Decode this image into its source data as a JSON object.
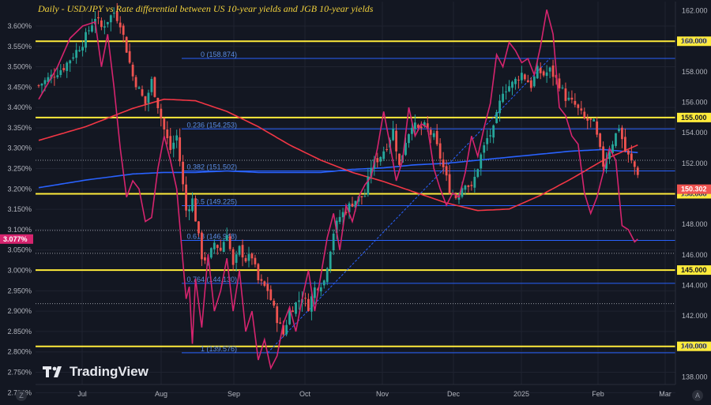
{
  "title": "Daily - USD/JPY vs Rate differential between US 10-year yields and JGB 10-year yields",
  "brand": "TradingView",
  "axis_buttons": {
    "left": "Z",
    "right": "A"
  },
  "colors": {
    "background": "#131722",
    "grid": "#1f2330",
    "candle_up": "#26a69a",
    "candle_down": "#ef5350",
    "spread_line": "#d6246e",
    "ma_red": "#f23645",
    "ma_blue": "#2962ff",
    "levels": "#ffeb3b",
    "fib": "#2962ff"
  },
  "chart_data": {
    "type": "candlestick",
    "left_axis": {
      "unit": "%",
      "range": [
        2.72,
        3.66
      ],
      "ticks": [
        "3.600%",
        "3.550%",
        "3.500%",
        "3.450%",
        "3.400%",
        "3.350%",
        "3.300%",
        "3.250%",
        "3.200%",
        "3.150%",
        "3.100%",
        "3.050%",
        "3.000%",
        "2.950%",
        "2.900%",
        "2.850%",
        "2.800%",
        "2.750%",
        "2.700%"
      ]
    },
    "right_axis": {
      "range": [
        137.5,
        162.6
      ],
      "ticks": [
        "162.000",
        "160.000",
        "158.000",
        "156.000",
        "154.000",
        "152.000",
        "150.000",
        "148.000",
        "146.000",
        "144.000",
        "142.000",
        "140.000",
        "138.000"
      ]
    },
    "x_ticks": [
      "Jul",
      "Aug",
      "Sep",
      "Oct",
      "Nov",
      "Dec",
      "2025",
      "Feb",
      "Mar"
    ],
    "last_price": "150.302",
    "last_spread": "3.077%",
    "horizontal_levels": [
      "160.000",
      "155.000",
      "150.000",
      "145.000",
      "140.000"
    ],
    "fib_levels": [
      {
        "label": "0 (158.874)",
        "price": 158.874
      },
      {
        "label": "0.236 (154.253)",
        "price": 154.253
      },
      {
        "label": "0.382 (151.502)",
        "price": 151.502
      },
      {
        "label": "0.5 (149.225)",
        "price": 149.225
      },
      {
        "label": "0.618 (146.948)",
        "price": 146.948
      },
      {
        "label": "0.764 (144.130)",
        "price": 144.13
      },
      {
        "label": "1 (139.576)",
        "price": 139.576
      }
    ],
    "dotted_levels": [
      152.2,
      147.6,
      146.1,
      142.8
    ],
    "usdjpy_key_points": [
      [
        0,
        157.1
      ],
      [
        8,
        158.3
      ],
      [
        14,
        159.9
      ],
      [
        18,
        161.6
      ],
      [
        20,
        160.9
      ],
      [
        24,
        161.9
      ],
      [
        26,
        161.2
      ],
      [
        30,
        157.7
      ],
      [
        34,
        155.9
      ],
      [
        36,
        157.4
      ],
      [
        40,
        154.2
      ],
      [
        42,
        152.9
      ],
      [
        44,
        153.8
      ],
      [
        47,
        148.9
      ],
      [
        49,
        149.6
      ],
      [
        52,
        145.9
      ],
      [
        54,
        145.6
      ],
      [
        56,
        146.8
      ],
      [
        58,
        146.3
      ],
      [
        60,
        147.5
      ],
      [
        62,
        145.2
      ],
      [
        64,
        146.4
      ],
      [
        66,
        145.7
      ],
      [
        68,
        145.9
      ],
      [
        70,
        144.3
      ],
      [
        73,
        143.7
      ],
      [
        76,
        141.8
      ],
      [
        78,
        140.8
      ],
      [
        80,
        142.3
      ],
      [
        84,
        143.3
      ],
      [
        86,
        142.6
      ],
      [
        88,
        143.8
      ],
      [
        91,
        144.3
      ],
      [
        94,
        147.5
      ],
      [
        96,
        148.5
      ],
      [
        99,
        149.2
      ],
      [
        101,
        149.6
      ],
      [
        104,
        149.9
      ],
      [
        106,
        151.8
      ],
      [
        109,
        152.5
      ],
      [
        111,
        153.2
      ],
      [
        113,
        154.2
      ],
      [
        115,
        151.8
      ],
      [
        117,
        153.5
      ],
      [
        119,
        154.6
      ],
      [
        121,
        154.2
      ],
      [
        123,
        154.4
      ],
      [
        126,
        153.7
      ],
      [
        128,
        152.4
      ],
      [
        131,
        150.3
      ],
      [
        133,
        149.8
      ],
      [
        136,
        150.8
      ],
      [
        138,
        150.3
      ],
      [
        141,
        152.5
      ],
      [
        143,
        153.6
      ],
      [
        145,
        154.2
      ],
      [
        148,
        156.8
      ],
      [
        151,
        157.2
      ],
      [
        154,
        157.9
      ],
      [
        157,
        157.1
      ],
      [
        159,
        158.1
      ],
      [
        161,
        157.8
      ],
      [
        163,
        158.1
      ],
      [
        166,
        157.2
      ],
      [
        168,
        156.3
      ],
      [
        171,
        155.8
      ],
      [
        174,
        154.9
      ],
      [
        177,
        154.6
      ],
      [
        180,
        151.9
      ],
      [
        183,
        153.4
      ],
      [
        185,
        154.4
      ],
      [
        187,
        152.8
      ],
      [
        189,
        152.1
      ],
      [
        191,
        151.4
      ]
    ],
    "spread_key_points": [
      [
        0,
        3.42
      ],
      [
        6,
        3.5
      ],
      [
        10,
        3.57
      ],
      [
        14,
        3.6
      ],
      [
        18,
        3.61
      ],
      [
        20,
        3.5
      ],
      [
        22,
        3.58
      ],
      [
        24,
        3.45
      ],
      [
        26,
        3.3
      ],
      [
        28,
        3.18
      ],
      [
        30,
        3.22
      ],
      [
        32,
        3.2
      ],
      [
        34,
        3.12
      ],
      [
        36,
        3.13
      ],
      [
        38,
        3.25
      ],
      [
        40,
        3.33
      ],
      [
        42,
        3.27
      ],
      [
        44,
        3.2
      ],
      [
        46,
        3.02
      ],
      [
        47,
        2.93
      ],
      [
        48,
        2.96
      ],
      [
        49,
        2.82
      ],
      [
        50,
        2.98
      ],
      [
        52,
        2.86
      ],
      [
        54,
        3.04
      ],
      [
        56,
        2.9
      ],
      [
        58,
        2.95
      ],
      [
        60,
        3.03
      ],
      [
        62,
        2.9
      ],
      [
        64,
        3.0
      ],
      [
        66,
        2.85
      ],
      [
        68,
        2.9
      ],
      [
        70,
        2.78
      ],
      [
        72,
        2.83
      ],
      [
        74,
        2.76
      ],
      [
        76,
        2.79
      ],
      [
        78,
        2.87
      ],
      [
        80,
        2.91
      ],
      [
        82,
        2.85
      ],
      [
        84,
        2.93
      ],
      [
        86,
        3.0
      ],
      [
        88,
        2.9
      ],
      [
        90,
        2.99
      ],
      [
        92,
        3.08
      ],
      [
        94,
        3.14
      ],
      [
        96,
        3.05
      ],
      [
        98,
        3.16
      ],
      [
        100,
        3.12
      ],
      [
        102,
        3.18
      ],
      [
        104,
        3.21
      ],
      [
        106,
        3.23
      ],
      [
        108,
        3.3
      ],
      [
        110,
        3.39
      ],
      [
        112,
        3.31
      ],
      [
        114,
        3.22
      ],
      [
        116,
        3.27
      ],
      [
        118,
        3.4
      ],
      [
        120,
        3.33
      ],
      [
        122,
        3.36
      ],
      [
        124,
        3.35
      ],
      [
        126,
        3.25
      ],
      [
        128,
        3.2
      ],
      [
        130,
        3.16
      ],
      [
        132,
        3.19
      ],
      [
        134,
        3.18
      ],
      [
        136,
        3.24
      ],
      [
        138,
        3.33
      ],
      [
        140,
        3.28
      ],
      [
        142,
        3.35
      ],
      [
        144,
        3.41
      ],
      [
        146,
        3.53
      ],
      [
        148,
        3.5
      ],
      [
        150,
        3.56
      ],
      [
        152,
        3.54
      ],
      [
        154,
        3.51
      ],
      [
        156,
        3.52
      ],
      [
        158,
        3.48
      ],
      [
        160,
        3.55
      ],
      [
        162,
        3.64
      ],
      [
        164,
        3.58
      ],
      [
        166,
        3.4
      ],
      [
        168,
        3.38
      ],
      [
        170,
        3.33
      ],
      [
        172,
        3.31
      ],
      [
        174,
        3.19
      ],
      [
        176,
        3.14
      ],
      [
        178,
        3.18
      ],
      [
        180,
        3.24
      ],
      [
        182,
        3.3
      ],
      [
        184,
        3.27
      ],
      [
        186,
        3.11
      ],
      [
        188,
        3.1
      ],
      [
        190,
        3.07
      ],
      [
        191,
        3.077
      ]
    ],
    "red_ma_key_points": [
      [
        0,
        153.5
      ],
      [
        15,
        154.4
      ],
      [
        30,
        155.6
      ],
      [
        40,
        156.2
      ],
      [
        50,
        156.1
      ],
      [
        60,
        155.4
      ],
      [
        70,
        154.4
      ],
      [
        80,
        153.2
      ],
      [
        90,
        152.2
      ],
      [
        100,
        151.4
      ],
      [
        110,
        150.8
      ],
      [
        120,
        150.1
      ],
      [
        130,
        149.4
      ],
      [
        140,
        148.9
      ],
      [
        150,
        149.0
      ],
      [
        160,
        149.9
      ],
      [
        170,
        151.0
      ],
      [
        180,
        152.2
      ],
      [
        191,
        153.2
      ]
    ],
    "blue_ma_key_points": [
      [
        0,
        150.4
      ],
      [
        15,
        150.9
      ],
      [
        30,
        151.3
      ],
      [
        40,
        151.4
      ],
      [
        50,
        151.4
      ],
      [
        60,
        151.5
      ],
      [
        70,
        151.4
      ],
      [
        80,
        151.4
      ],
      [
        90,
        151.4
      ],
      [
        100,
        151.6
      ],
      [
        110,
        151.7
      ],
      [
        120,
        151.9
      ],
      [
        130,
        152.0
      ],
      [
        140,
        152.2
      ],
      [
        150,
        152.4
      ],
      [
        160,
        152.6
      ],
      [
        170,
        152.8
      ],
      [
        180,
        152.9
      ],
      [
        191,
        152.7
      ]
    ]
  }
}
